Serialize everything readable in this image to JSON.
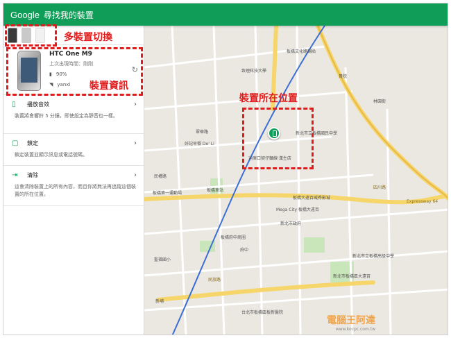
{
  "appbar": {
    "brand": "Google",
    "title": "尋找我的裝置"
  },
  "device": {
    "name": "HTC One M9",
    "last_seen": "上次出現時間：剛剛",
    "battery": "90%",
    "wifi": "yanxi"
  },
  "actions": [
    {
      "title": "播放音效",
      "desc": "裝置將會響鈴 5 分鐘，即使設定為靜音也一樣。"
    },
    {
      "title": "鎖定",
      "desc": "鎖定裝置並顯示訊息或電話號碼。"
    },
    {
      "title": "清除",
      "desc": "這會清除裝置上的所有內容，而且你將無法再追蹤這個裝置的所在位置。"
    }
  ],
  "annotations": {
    "switch": "多裝置切換",
    "info": "裝置資訊",
    "location": "裝置所在位置"
  },
  "map": {
    "labels": [
      "板橋文化路鍋貼",
      "致理科技大學",
      "新北市立板橋國民中學",
      "迪庫口契仔麵線·漢生店",
      "好記早餐 De' Li",
      "民權路",
      "板橋大遠百威秀影城",
      "Mega City 板橋大遠百",
      "新北市政府",
      "板橋府中商圈",
      "府中",
      "新北市立板橋高級中學",
      "板橋第一運動場",
      "民族路",
      "台北市板橋區板新醫院",
      "貴院",
      "林園街",
      "四川路",
      "翠華路",
      "Expressway 64",
      "聖福國小",
      "板橋車站",
      "新埔",
      "新北市板橋區大遠百"
    ]
  },
  "watermark": {
    "name": "電腦王阿達",
    "url": "www.kocpc.com.tw"
  }
}
